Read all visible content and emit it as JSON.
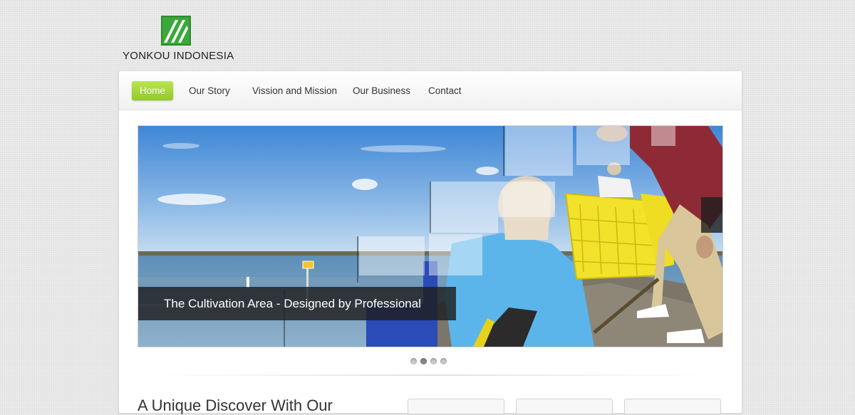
{
  "brand": {
    "name": "YONKOU INDONESIA",
    "color": "#3a9a2a"
  },
  "nav": {
    "items": [
      {
        "label": "Home",
        "active": true
      },
      {
        "label": "Our Story",
        "active": false
      },
      {
        "label": "Vission and Mission",
        "active": false
      },
      {
        "label": "Our Business",
        "active": false
      },
      {
        "label": "Contact",
        "active": false
      }
    ],
    "active_color": "#a6d63a"
  },
  "slider": {
    "caption": "The Cultivation Area - Designed by Professional",
    "slide_count": 4,
    "active_slide": 2
  },
  "content": {
    "heading_partial": "A Unique Discover With Our"
  }
}
